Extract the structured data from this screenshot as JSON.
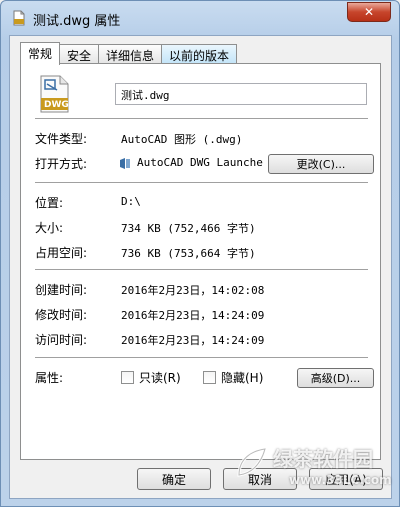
{
  "window": {
    "title": "测试.dwg 属性",
    "close_glyph": "✕"
  },
  "tabs": [
    {
      "label": "常规",
      "active": true
    },
    {
      "label": "安全",
      "active": false
    },
    {
      "label": "详细信息",
      "active": false
    },
    {
      "label": "以前的版本",
      "active": false
    }
  ],
  "general": {
    "icon_text": "DWG",
    "filename": "测试.dwg",
    "file_type_label": "文件类型:",
    "file_type_value": "AutoCAD 图形 (.dwg)",
    "open_with_label": "打开方式:",
    "open_with_value": "AutoCAD DWG Launche",
    "change_button": "更改(C)...",
    "location_label": "位置:",
    "location_value": "D:\\",
    "size_label": "大小:",
    "size_value": "734 KB (752,466 字节)",
    "disk_size_label": "占用空间:",
    "disk_size_value": "736 KB (753,664 字节)",
    "created_label": "创建时间:",
    "created_value": "2016年2月23日，14:02:08",
    "modified_label": "修改时间:",
    "modified_value": "2016年2月23日，14:24:09",
    "accessed_label": "访问时间:",
    "accessed_value": "2016年2月23日，14:24:09",
    "attributes_label": "属性:",
    "readonly_label": "只读(R)",
    "hidden_label": "隐藏(H)",
    "advanced_button": "高级(D)..."
  },
  "footer": {
    "ok_button": "确定",
    "cancel_button": "取消",
    "apply_button": "应用(A)"
  },
  "watermark": {
    "text": "绿茶软件园",
    "url": "www.33LC.com"
  },
  "colors": {
    "accent": "#3c7fb1",
    "dwg_icon": "#c99a1e"
  }
}
